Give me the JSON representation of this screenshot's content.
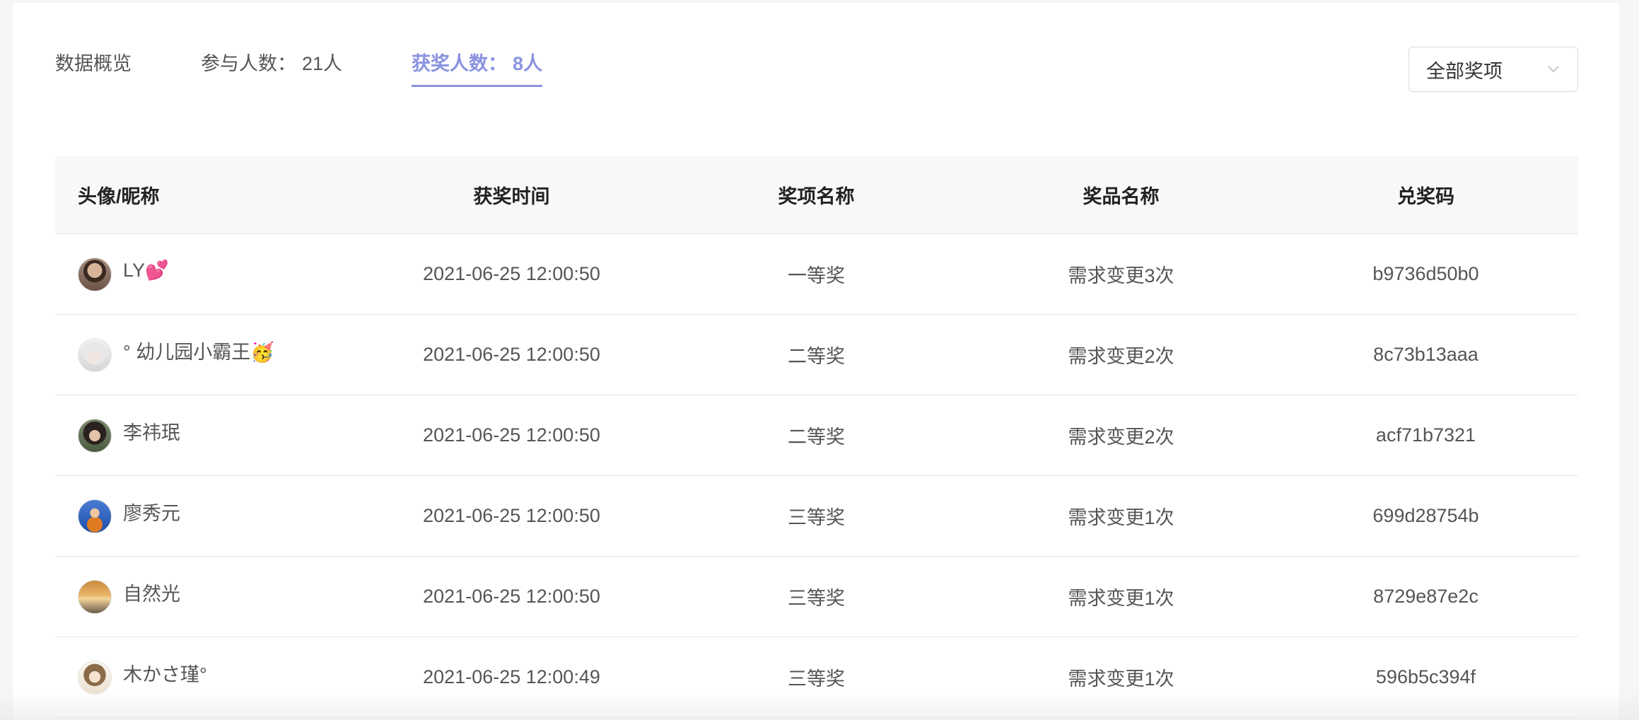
{
  "tabs": {
    "overview": "数据概览",
    "participants_label": "参与人数：",
    "participants_count": "21人",
    "winners_label": "获奖人数：",
    "winners_count": "8人"
  },
  "filter": {
    "selected": "全部奖项"
  },
  "colors": {
    "accent": "#8a93e0",
    "header_bg": "#f8f8f8",
    "border": "#e6e6e6"
  },
  "table": {
    "headers": [
      "头像/昵称",
      "获奖时间",
      "奖项名称",
      "奖品名称",
      "兑奖码"
    ],
    "rows": [
      {
        "nickname": "LY💕",
        "time": "2021-06-25 12:00:50",
        "award": "一等奖",
        "prize": "需求变更3次",
        "code": "b9736d50b0"
      },
      {
        "nickname": "° 幼儿园小霸王🥳",
        "time": "2021-06-25 12:00:50",
        "award": "二等奖",
        "prize": "需求变更2次",
        "code": "8c73b13aaa"
      },
      {
        "nickname": "李祎珉",
        "time": "2021-06-25 12:00:50",
        "award": "二等奖",
        "prize": "需求变更2次",
        "code": "acf71b7321"
      },
      {
        "nickname": "廖秀元",
        "time": "2021-06-25 12:00:50",
        "award": "三等奖",
        "prize": "需求变更1次",
        "code": "699d28754b"
      },
      {
        "nickname": "自然光",
        "time": "2021-06-25 12:00:50",
        "award": "三等奖",
        "prize": "需求变更1次",
        "code": "8729e87e2c"
      },
      {
        "nickname": "木かさ瑾°",
        "time": "2021-06-25 12:00:49",
        "award": "三等奖",
        "prize": "需求变更1次",
        "code": "596b5c394f"
      }
    ]
  }
}
